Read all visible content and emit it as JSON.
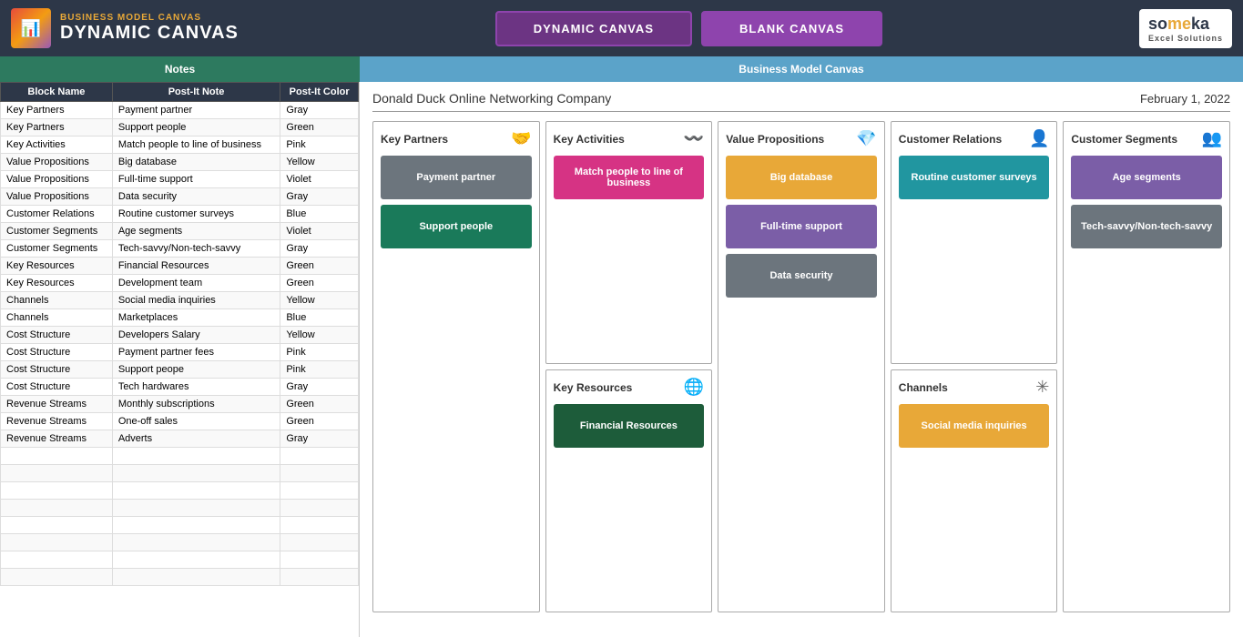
{
  "header": {
    "subtitle": "BUSINESS MODEL CANVAS",
    "title": "DYNAMIC CANVAS",
    "nav": {
      "dynamic_label": "DYNAMIC CANVAS",
      "blank_label": "BLANK CANVAS"
    },
    "brand_main": "so",
    "brand_accent": "me",
    "brand_rest": "ka",
    "brand_sub": "Excel Solutions"
  },
  "sections": {
    "notes_label": "Notes",
    "canvas_label": "Business Model Canvas"
  },
  "table": {
    "headers": [
      "Block Name",
      "Post-It Note",
      "Post-It Color"
    ],
    "rows": [
      [
        "Key Partners",
        "Payment partner",
        "Gray"
      ],
      [
        "Key Partners",
        "Support people",
        "Green"
      ],
      [
        "Key Activities",
        "Match people to line of business",
        "Pink"
      ],
      [
        "Value Propositions",
        "Big database",
        "Yellow"
      ],
      [
        "Value Propositions",
        "Full-time support",
        "Violet"
      ],
      [
        "Value Propositions",
        "Data security",
        "Gray"
      ],
      [
        "Customer Relations",
        "Routine customer surveys",
        "Blue"
      ],
      [
        "Customer Segments",
        "Age segments",
        "Violet"
      ],
      [
        "Customer Segments",
        "Tech-savvy/Non-tech-savvy",
        "Gray"
      ],
      [
        "Key Resources",
        "Financial Resources",
        "Green"
      ],
      [
        "Key Resources",
        "Development team",
        "Green"
      ],
      [
        "Channels",
        "Social media inquiries",
        "Yellow"
      ],
      [
        "Channels",
        "Marketplaces",
        "Blue"
      ],
      [
        "Cost Structure",
        "Developers Salary",
        "Yellow"
      ],
      [
        "Cost Structure",
        "Payment partner fees",
        "Pink"
      ],
      [
        "Cost Structure",
        "Support peope",
        "Pink"
      ],
      [
        "Cost Structure",
        "Tech hardwares",
        "Gray"
      ],
      [
        "Revenue Streams",
        "Monthly subscriptions",
        "Green"
      ],
      [
        "Revenue Streams",
        "One-off sales",
        "Green"
      ],
      [
        "Revenue Streams",
        "Adverts",
        "Gray"
      ]
    ]
  },
  "canvas": {
    "company": "Donald Duck Online Networking Company",
    "date": "February 1, 2022",
    "blocks": {
      "key_partners": {
        "title": "Key Partners",
        "icon": "🤝",
        "cards": [
          {
            "label": "Payment partner",
            "color": "gray"
          },
          {
            "label": "Support people",
            "color": "green"
          }
        ]
      },
      "key_activities": {
        "title": "Key Activities",
        "icon": "〰",
        "cards": [
          {
            "label": "Match people to line of business",
            "color": "pink"
          }
        ]
      },
      "value_propositions": {
        "title": "Value Propositions",
        "icon": "💎",
        "cards": [
          {
            "label": "Big database",
            "color": "yellow"
          },
          {
            "label": "Full-time support",
            "color": "violet"
          },
          {
            "label": "Data security",
            "color": "gray"
          }
        ]
      },
      "customer_relations": {
        "title": "Customer Relations",
        "icon": "👤",
        "cards": [
          {
            "label": "Routine customer surveys",
            "color": "teal"
          }
        ]
      },
      "customer_segments": {
        "title": "Customer Segments",
        "icon": "👥",
        "cards": [
          {
            "label": "Age segments",
            "color": "violet"
          },
          {
            "label": "Tech-savvy/Non-tech-savvy",
            "color": "gray"
          }
        ]
      },
      "key_resources": {
        "title": "Key Resources",
        "icon": "🌐",
        "cards": [
          {
            "label": "Financial Resources",
            "color": "dark-green"
          }
        ]
      },
      "channels": {
        "title": "Channels",
        "icon": "✳",
        "cards": [
          {
            "label": "Social media inquiries",
            "color": "yellow"
          }
        ]
      }
    }
  }
}
